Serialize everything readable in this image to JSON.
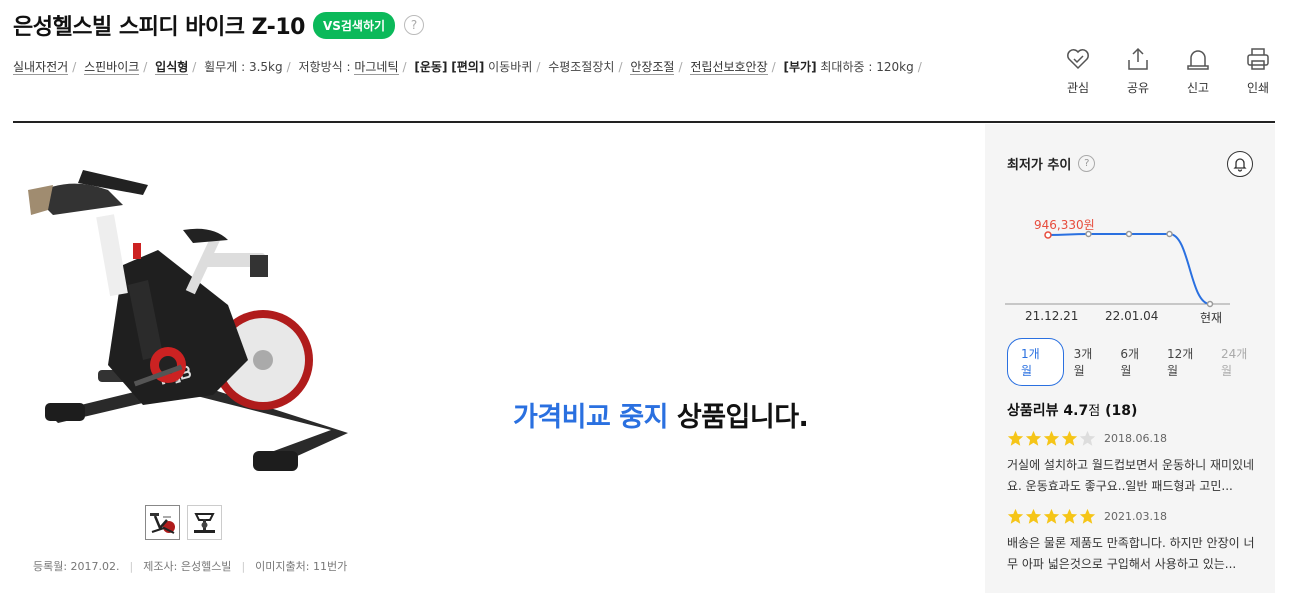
{
  "product": {
    "title": "은성헬스빌 스피디 바이크 Z-10",
    "vs_label": "VS검색하기",
    "help": "?"
  },
  "specs": [
    {
      "text": "실내자전거",
      "style": "lnk"
    },
    {
      "text": "스핀바이크",
      "style": "lnk"
    },
    {
      "text": "입식형",
      "style": "lnk bold"
    },
    {
      "text": "휠무게 : 3.5kg",
      "style": "plain"
    },
    {
      "text": "저항방식 : ",
      "style": "plain",
      "link": "마그네틱"
    },
    {
      "text": "[운동]",
      "style": "bold",
      "suffix": ""
    },
    {
      "text": "[편의]",
      "style": "bold",
      "suffix": " 이동바퀴"
    },
    {
      "text": "수평조절장치",
      "style": "plain"
    },
    {
      "text": "안장조절",
      "style": "lnk"
    },
    {
      "text": "전립선보호안장",
      "style": "lnk"
    },
    {
      "text": "[부가]",
      "style": "bold",
      "suffix": " 최대하중 : 120kg"
    }
  ],
  "actions": [
    {
      "label": "관심",
      "icon": "heart-check-icon"
    },
    {
      "label": "공유",
      "icon": "share-icon"
    },
    {
      "label": "신고",
      "icon": "siren-icon"
    },
    {
      "label": "인쇄",
      "icon": "print-icon"
    }
  ],
  "meta": {
    "registered": "등록월: 2017.02.",
    "maker": "제조사: 은성헬스빌",
    "image_source": "이미지출처: 11번가"
  },
  "status": {
    "highlight": "가격비교 중지",
    "rest": " 상품입니다."
  },
  "price_panel": {
    "title": "최저가 추이",
    "help": "?",
    "price_label": "946,330원",
    "x_labels": [
      "21.12.21",
      "22.01.04",
      "현재"
    ],
    "periods": [
      "1개월",
      "3개월",
      "6개월",
      "12개월",
      "24개월"
    ],
    "active_period": "1개월"
  },
  "chart_data": {
    "type": "line",
    "x": [
      "21.12.21",
      "",
      "22.01.04",
      "",
      "현재"
    ],
    "values": [
      946330,
      960000,
      960000,
      960000,
      0
    ],
    "lowest_label": "946,330원"
  },
  "reviews": {
    "title": "상품리뷰",
    "score": "4.7",
    "score_unit": "점",
    "count": "(18)",
    "items": [
      {
        "stars": 4,
        "date": "2018.06.18",
        "text": "거실에 설치하고 월드컵보면서 운동하니 재미있네요. 운동효과도 좋구요..일반 패드형과 고민..."
      },
      {
        "stars": 5,
        "date": "2021.03.18",
        "text": "배송은 물론 제품도 만족합니다. 하지만 안장이 너무 아파 넓은것으로 구입해서 사용하고 있는..."
      }
    ]
  },
  "colors": {
    "accent": "#2a70e0",
    "vs": "#0bb95a",
    "price": "#e74c3c",
    "star": "#f5c518"
  }
}
